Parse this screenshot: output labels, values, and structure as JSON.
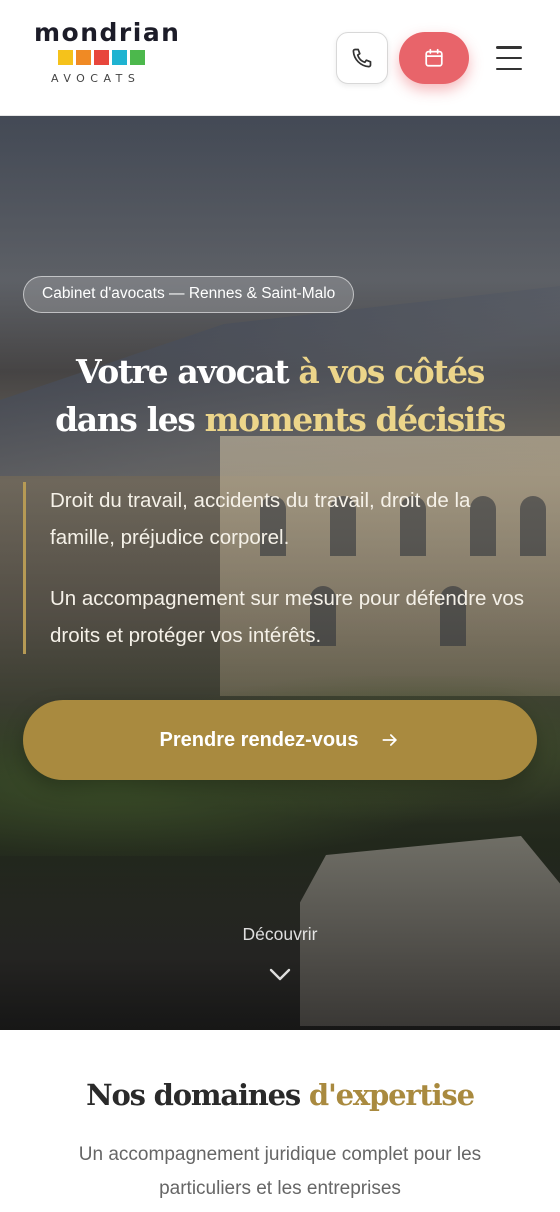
{
  "header": {
    "logo": {
      "word": "mondrian",
      "sub": "AVOCATS",
      "square_colors": [
        "#f5c21b",
        "#f08a24",
        "#e8463c",
        "#1fb3d1",
        "#4cb84c"
      ]
    },
    "phone_button_icon": "phone-icon",
    "calendar_button_icon": "calendar-icon",
    "menu_icon": "hamburger-menu-icon",
    "accent_color": "#e8646a"
  },
  "hero": {
    "badge": "Cabinet d'avocats — Rennes & Saint-Malo",
    "title_line1_white": "Votre avocat ",
    "title_line1_gold": "à vos côtés",
    "title_line2_white": "dans les ",
    "title_line2_gold": "moments décisifs",
    "paragraph1": "Droit du travail, accidents du travail, droit de la famille, préjudice corporel.",
    "paragraph2": "Un accompagnement sur mesure pour défendre vos droits et protéger vos intérêts.",
    "cta_label": "Prendre rendez-vous",
    "cta_icon": "arrow-right-icon",
    "discover_label": "Découvrir",
    "discover_icon": "chevron-down-icon",
    "gold_color": "#a98a3f"
  },
  "expertise": {
    "title_dark": "Nos domaines ",
    "title_gold": "d'expertise",
    "subtitle": "Un accompagnement juridique complet pour les particuliers et les entreprises"
  }
}
